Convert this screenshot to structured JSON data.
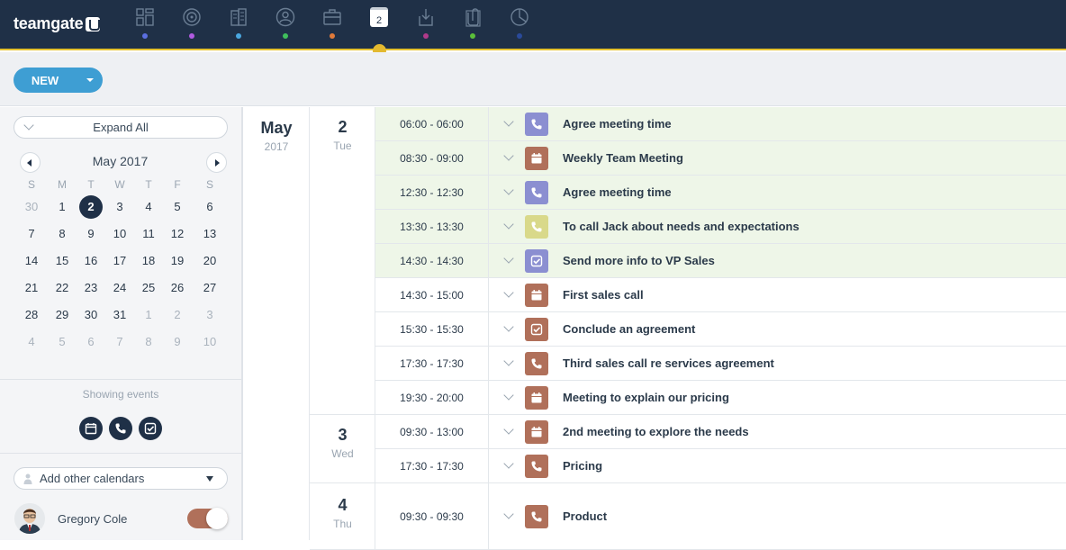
{
  "app": {
    "logo_text": "teamgate"
  },
  "nav": {
    "items": [
      {
        "name": "dashboard-icon",
        "dot": "#5b6fe0"
      },
      {
        "name": "target-icon",
        "dot": "#b05be0"
      },
      {
        "name": "buildings-icon",
        "dot": "#4aa8e0"
      },
      {
        "name": "person-icon",
        "dot": "#3fbf5c"
      },
      {
        "name": "briefcase-icon",
        "dot": "#e07a3a"
      },
      {
        "name": "calendar-icon",
        "day": "2",
        "active": true
      },
      {
        "name": "inbox-icon",
        "dot": "#b03a8a"
      },
      {
        "name": "paperclip-icon",
        "dot": "#5bbf3a"
      },
      {
        "name": "pie-chart-icon",
        "dot": "#2a4a9a"
      }
    ]
  },
  "toolbar": {
    "new_label": "NEW"
  },
  "sidebar": {
    "expand_label": "Expand All",
    "calendar": {
      "month_title": "May 2017",
      "weekdays": [
        "S",
        "M",
        "T",
        "W",
        "T",
        "F",
        "S"
      ],
      "weeks": [
        [
          "30",
          "1",
          "2",
          "3",
          "4",
          "5",
          "6"
        ],
        [
          "7",
          "8",
          "9",
          "10",
          "11",
          "12",
          "13"
        ],
        [
          "14",
          "15",
          "16",
          "17",
          "18",
          "19",
          "20"
        ],
        [
          "21",
          "22",
          "23",
          "24",
          "25",
          "26",
          "27"
        ],
        [
          "28",
          "29",
          "30",
          "31",
          "1",
          "2",
          "3"
        ],
        [
          "4",
          "5",
          "6",
          "7",
          "8",
          "9",
          "10"
        ]
      ],
      "today": "2"
    },
    "showing_label": "Showing events",
    "add_calendars_label": "Add other calendars",
    "user_name": "Gregory Cole"
  },
  "agenda": {
    "month": "May",
    "year": "2017",
    "days": [
      {
        "num": "2",
        "dow": "Tue",
        "events": [
          {
            "time": "06:00 - 06:00",
            "title": "Agree meeting time",
            "type": "call",
            "color": "#8b8fd1",
            "past": true
          },
          {
            "time": "08:30 - 09:00",
            "title": "Weekly Team Meeting",
            "type": "meeting",
            "color": "#b0705a",
            "past": true
          },
          {
            "time": "12:30 - 12:30",
            "title": "Agree meeting time",
            "type": "call",
            "color": "#8b8fd1",
            "past": true
          },
          {
            "time": "13:30 - 13:30",
            "title": "To call Jack about needs and expectations",
            "type": "call",
            "color": "#d9d98a",
            "past": true
          },
          {
            "time": "14:30 - 14:30",
            "title": "Send more info to VP Sales",
            "type": "task",
            "color": "#8b8fd1",
            "past": true
          },
          {
            "time": "14:30 - 15:00",
            "title": "First sales call",
            "type": "meeting",
            "color": "#b0705a",
            "past": false
          },
          {
            "time": "15:30 - 15:30",
            "title": "Conclude an agreement",
            "type": "task",
            "color": "#b0705a",
            "past": false
          },
          {
            "time": "17:30 - 17:30",
            "title": "Third sales call re services agreement",
            "type": "call",
            "color": "#b0705a",
            "past": false
          },
          {
            "time": "19:30 - 20:00",
            "title": "Meeting to explain our pricing",
            "type": "meeting",
            "color": "#b0705a",
            "past": false
          }
        ]
      },
      {
        "num": "3",
        "dow": "Wed",
        "events": [
          {
            "time": "09:30 - 13:00",
            "title": "2nd meeting to explore the needs",
            "type": "meeting",
            "color": "#b0705a",
            "past": false
          },
          {
            "time": "17:30 - 17:30",
            "title": "Pricing",
            "type": "call",
            "color": "#b0705a",
            "past": false
          }
        ]
      },
      {
        "num": "4",
        "dow": "Thu",
        "events": [
          {
            "time": "09:30 - 09:30",
            "title": "Product",
            "type": "call",
            "color": "#b0705a",
            "past": false
          }
        ]
      }
    ]
  }
}
